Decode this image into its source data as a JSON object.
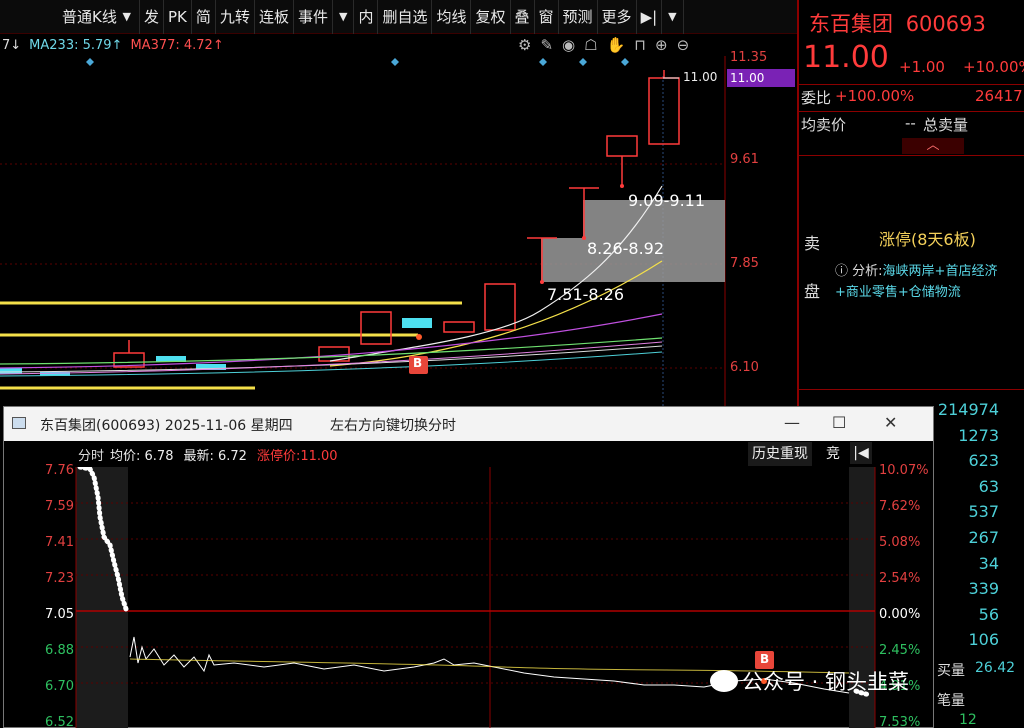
{
  "toolbar": {
    "period": "普通K线",
    "items": [
      "发",
      "PK",
      "简",
      "九转",
      "连板",
      "事件",
      "内",
      "删自选",
      "均线",
      "复权",
      "叠",
      "窗",
      "预测",
      "更多"
    ]
  },
  "ma": {
    "ma233": "MA233: 5.79↑",
    "ma377": "MA377: 4.72↑",
    "prefix": "7↓"
  },
  "kline": {
    "axis": [
      "11.35",
      "9.61",
      "7.85",
      "6.10"
    ],
    "last_price_box": "11.00",
    "last_price_label": "11.00",
    "zones": [
      "9.09-9.11",
      "8.26-8.92",
      "7.51-8.26"
    ],
    "buy_marker": "B"
  },
  "quote": {
    "name": "东百集团",
    "code": "600693",
    "price": "11.00",
    "change": "+1.00",
    "pct": "+10.00%",
    "weibi_label": "委比",
    "weibi_value": "+100.00%",
    "weibi_vol": "26417",
    "avg_sell_label": "均卖价",
    "avg_sell_value": "--",
    "total_sell_label": "总卖量",
    "sell_side_top": "卖",
    "sell_side_bottom": "盘",
    "limit_text": "涨停(8天6板)",
    "analysis_prefix": "分析:",
    "analysis_text": "海峡两岸+首店经济+商业零售+仓储物流",
    "volumes": [
      "214974",
      "1273",
      "623",
      "63",
      "537",
      "267",
      "34",
      "339",
      "56",
      "106"
    ],
    "buy_label": "买量",
    "buy_value": "26.42",
    "bottom_label": "笔量",
    "bottom_value": "12"
  },
  "popup": {
    "title": "东百集团(600693) 2025-11-06 星期四",
    "hint": "左右方向键切换分时",
    "btn_min": "—",
    "btn_max": "☐",
    "btn_close": "✕",
    "head_label": "分时",
    "avg": "均价: 6.78",
    "last": "最新: 6.72",
    "limit": "涨停价:11.00",
    "history_btn": "历史重现",
    "compete_btn": "竞",
    "left_axis": [
      "7.76",
      "7.59",
      "7.41",
      "7.23",
      "7.05",
      "6.88",
      "6.70",
      "6.52"
    ],
    "right_axis": [
      "10.07%",
      "7.62%",
      "5.08%",
      "2.54%",
      "0.00%",
      "2.45%",
      "4.91%",
      "7.53%"
    ],
    "buy_marker": "B"
  },
  "watermark": {
    "text": "公众号 · 钢头韭菜"
  },
  "colors": {
    "up": "#ff3b3b",
    "down": "#2ec060",
    "ma_yellow": "#f4e04a",
    "accent": "#7a22b5"
  }
}
